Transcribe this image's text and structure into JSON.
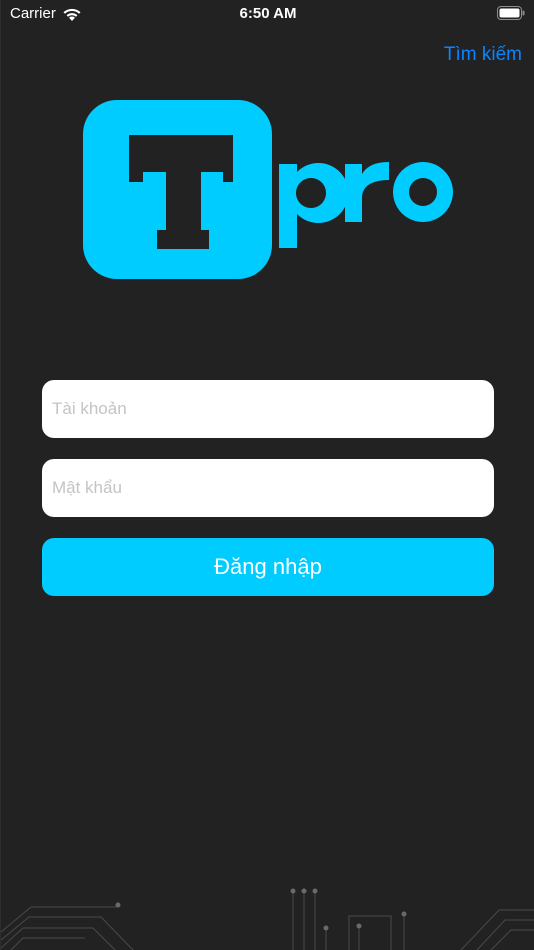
{
  "status_bar": {
    "carrier": "Carrier",
    "time": "6:50 AM",
    "wifi_icon": "wifi-icon",
    "battery_icon": "battery-icon"
  },
  "header": {
    "search_label": "Tìm kiếm"
  },
  "logo": {
    "letter": "T",
    "text": "pro",
    "color": "#00ccff"
  },
  "form": {
    "account": {
      "placeholder": "Tài khoản",
      "value": ""
    },
    "password": {
      "placeholder": "Mật khẩu",
      "value": ""
    },
    "login_label": "Đăng nhập"
  },
  "colors": {
    "background": "#222222",
    "accent": "#00ccff",
    "link": "#0a84ff"
  }
}
